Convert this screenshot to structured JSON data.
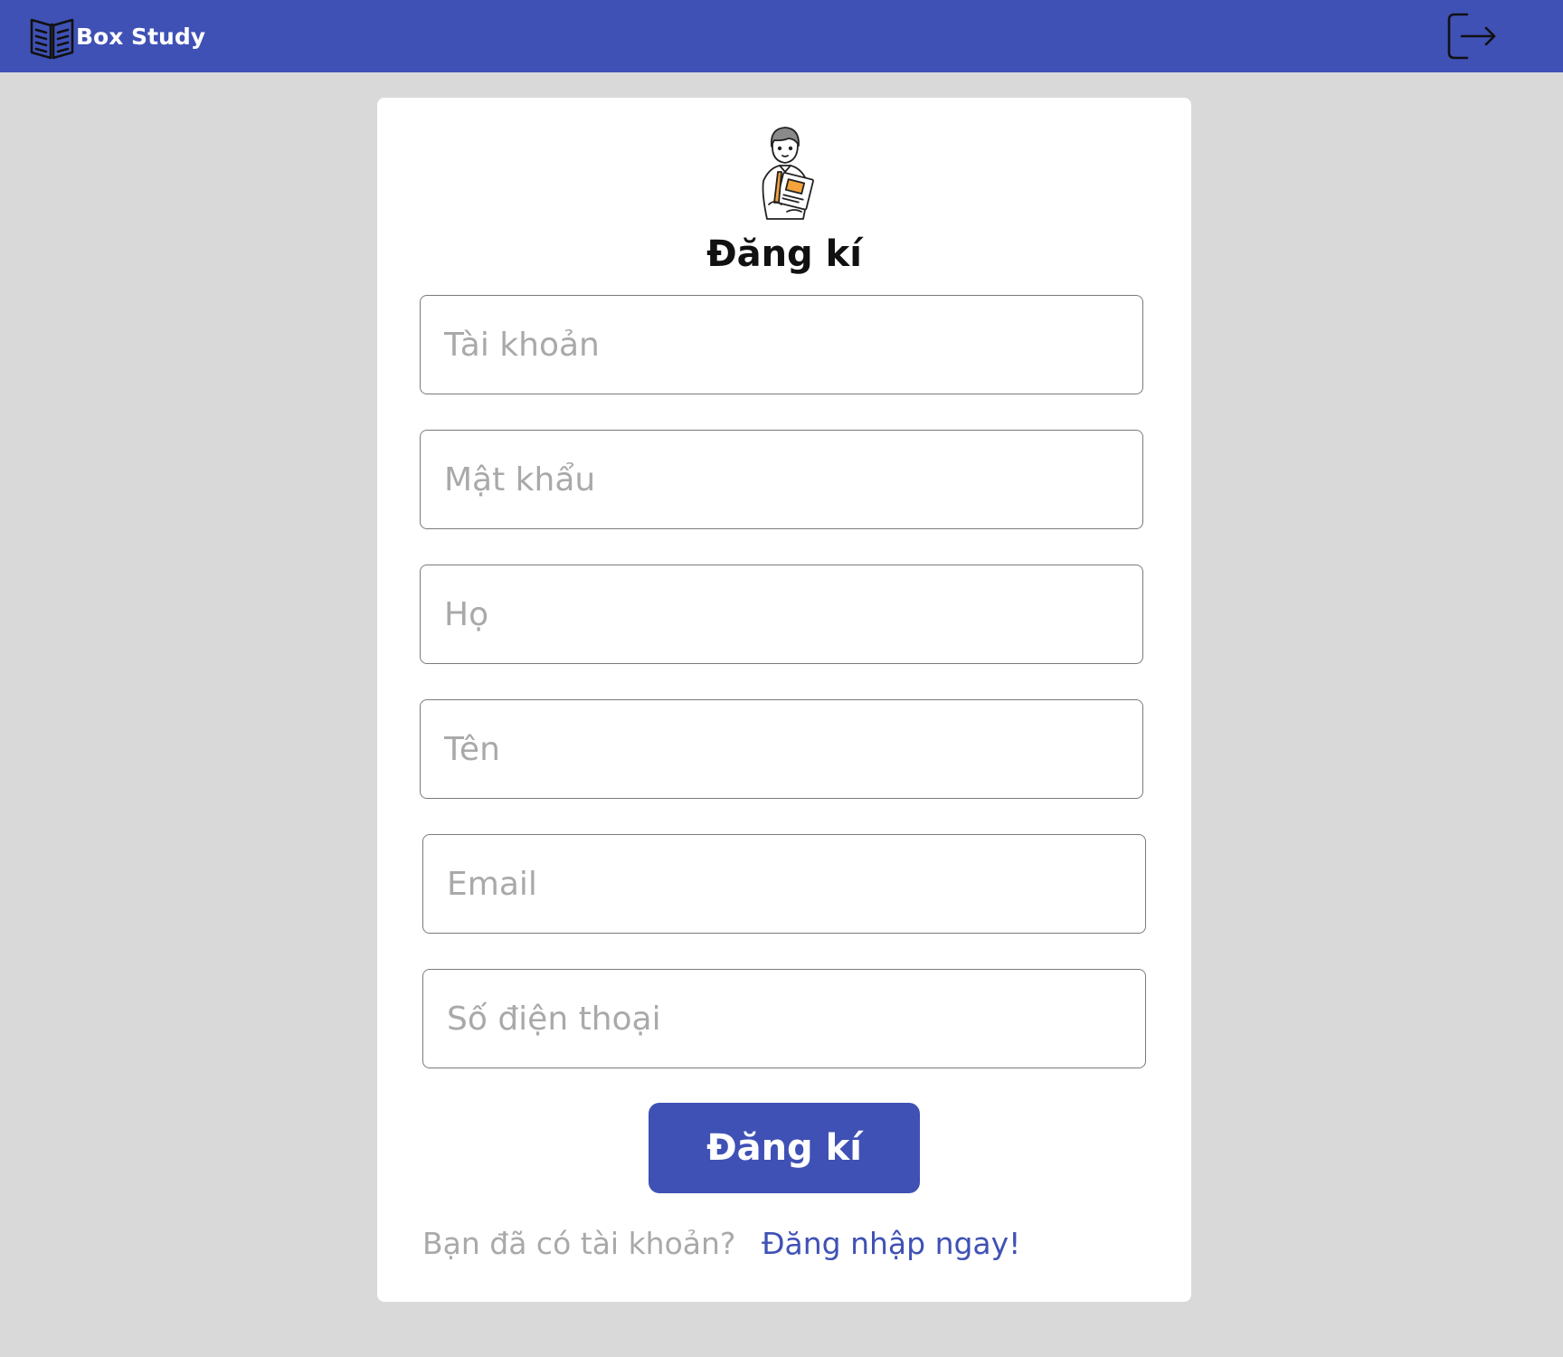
{
  "header": {
    "brand_name": "Box Study",
    "brand_icon": "book-icon",
    "logout_icon": "logout-icon",
    "background": "#3f51b5"
  },
  "form": {
    "title": "Đăng kí",
    "illustration": "student-reading-illustration",
    "fields": [
      {
        "name": "username",
        "placeholder": "Tài khoản",
        "value": ""
      },
      {
        "name": "password",
        "placeholder": "Mật khẩu",
        "value": ""
      },
      {
        "name": "last_name",
        "placeholder": "Họ",
        "value": ""
      },
      {
        "name": "first_name",
        "placeholder": "Tên",
        "value": ""
      },
      {
        "name": "email",
        "placeholder": "Email",
        "value": ""
      },
      {
        "name": "phone",
        "placeholder": "Số điện thoại",
        "value": ""
      }
    ],
    "submit_label": "Đăng kí",
    "signin_prompt": "Bạn đã có tài khoản?",
    "signin_link": "Đăng nhập ngay!"
  },
  "colors": {
    "accent": "#3f51b5",
    "page_background": "#d9d9d9",
    "placeholder": "#a9a9a9"
  }
}
